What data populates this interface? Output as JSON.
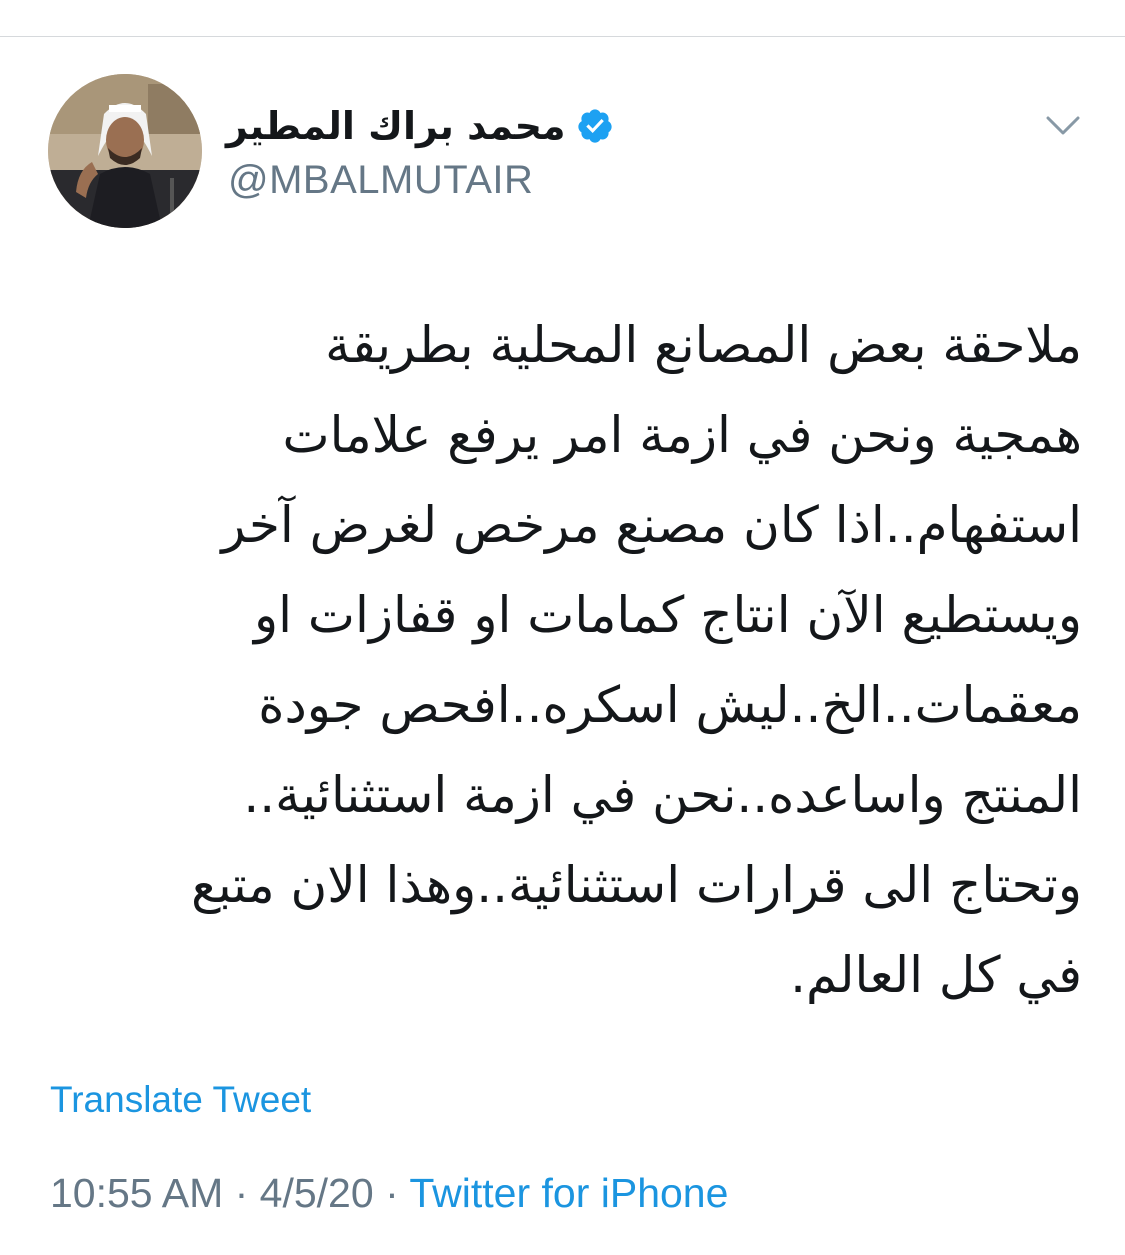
{
  "tweet": {
    "author": {
      "display_name": "محمد براك المطير",
      "handle": "@MBALMUTAIR",
      "verified": true
    },
    "icons": {
      "verified": "verified-badge-icon",
      "menu": "chevron-down-icon",
      "avatar": "profile-photo"
    },
    "text_lines": [
      "ملاحقة بعض المصانع المحلية بطريقة",
      "همجية ونحن في ازمة امر يرفع علامات",
      "استفهام..اذا كان مصنع مرخص لغرض آخر",
      "ويستطيع الآن انتاج كمامات او قفازات او",
      "معقمات..الخ..ليش اسكره..افحص جودة",
      "المنتج واساعده..نحن في ازمة استثنائية..",
      "وتحتاج الى قرارات استثنائية..وهذا الان متبع",
      "في كل العالم."
    ],
    "translate_label": "Translate Tweet",
    "time": "10:55 AM",
    "date": "4/5/20",
    "source": "Twitter for iPhone",
    "separator": " · "
  },
  "colors": {
    "link": "#1b95e0",
    "secondary_text": "#657786",
    "primary_text": "#14171a",
    "divider": "#d6d9dc"
  }
}
